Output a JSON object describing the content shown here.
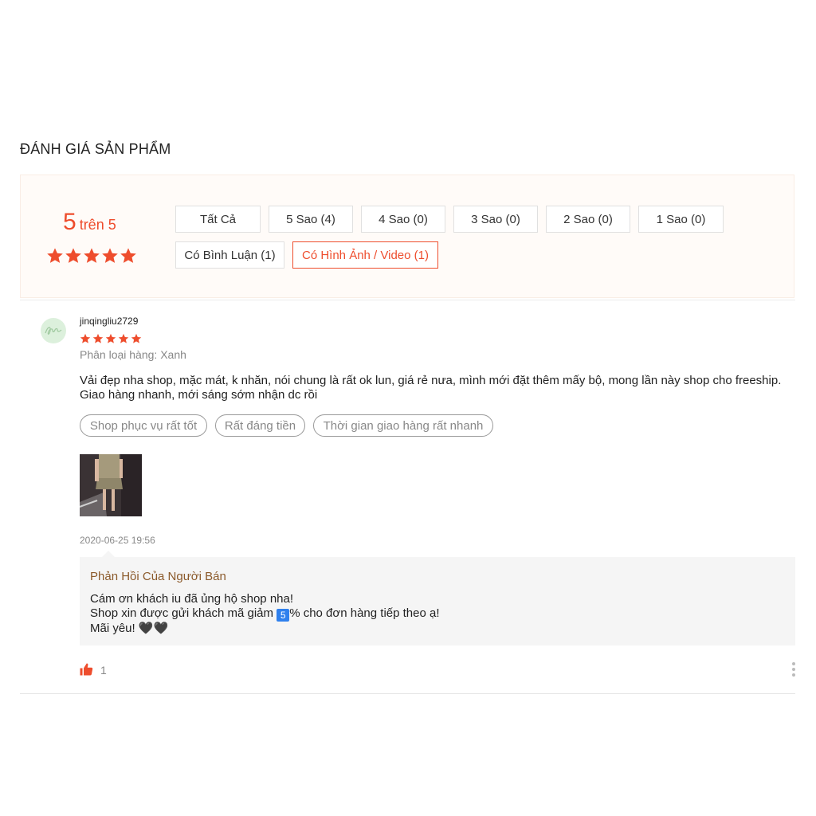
{
  "section": {
    "title": "ĐÁNH GIÁ SẢN PHẨM"
  },
  "overview": {
    "score": "5",
    "score_suffix": "trên 5",
    "stars": 5,
    "accent_color": "#ee4d2d",
    "filters": [
      {
        "label": "Tất Cả",
        "active": false
      },
      {
        "label": "5 Sao (4)",
        "active": false
      },
      {
        "label": "4 Sao (0)",
        "active": false
      },
      {
        "label": "3 Sao (0)",
        "active": false
      },
      {
        "label": "2 Sao (0)",
        "active": false
      },
      {
        "label": "1 Sao (0)",
        "active": false
      },
      {
        "label": "Có Bình Luận (1)",
        "active": false
      },
      {
        "label": "Có Hình Ảnh / Video (1)",
        "active": true
      }
    ]
  },
  "review": {
    "author": "jinqingliu2729",
    "stars": 5,
    "variation": "Phân loại hàng: Xanh",
    "text_lines": [
      "Vải đẹp nha shop, mặc mát, k nhăn, nói chung là rất ok lun, giá rẻ nưa, mình mới đặt thêm mấy bộ, mong lần này shop cho freeship.",
      "Giao hàng nhanh, mới sáng sớm nhận dc rồi"
    ],
    "tags": [
      "Shop phục vụ rất tốt",
      "Rất đáng tiền",
      "Thời gian giao hàng rất nhanh"
    ],
    "timestamp": "2020-06-25 19:56",
    "reply": {
      "title": "Phản Hồi Của Người Bán",
      "line1": "Cám ơn khách iu đã ủng hộ shop nha!",
      "line2_pre": "Shop xin được gửi khách mã giảm ",
      "line2_badge": "5",
      "line2_post": "% cho đơn hàng tiếp theo ạ!",
      "line3": "Mãi yêu! 🖤🖤"
    },
    "likes": "1",
    "icons": {
      "like": "thumbs-up-icon",
      "more": "more-vertical-icon",
      "star": "star-icon"
    }
  }
}
